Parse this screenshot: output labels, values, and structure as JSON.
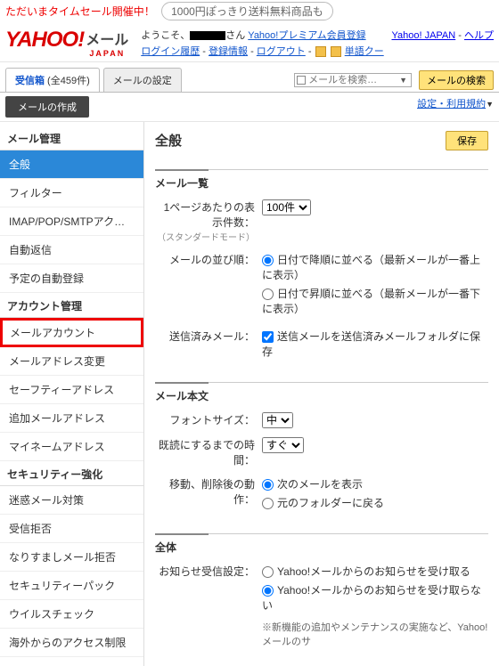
{
  "promo": {
    "sale": "ただいまタイムセール開催中！",
    "oval": "1000円ぽっきり送料無料商品も"
  },
  "header": {
    "yahoo": "YAHOO!",
    "japan": "JAPAN",
    "mail": "メール",
    "greeting_prefix": "ようこそ、",
    "greeting_suffix": "さん",
    "premium": "Yahoo!プレミアム会員登録",
    "login_history": "ログイン履歴",
    "reg_info": "登録情報",
    "logout": "ログアウト",
    "tango": "単語クー",
    "yj": "Yahoo! JAPAN",
    "help": "ヘルプ"
  },
  "tabs": {
    "inbox_label": "受信箱",
    "inbox_count": " (全459件)",
    "settings": "メールの設定"
  },
  "search": {
    "placeholder": "メールを検索…",
    "button": "メールの検索"
  },
  "subrow": {
    "compose": "メールの作成",
    "rules": "設定・利用規約"
  },
  "sidebar": {
    "h1": "メール管理",
    "g1": [
      "全般",
      "フィルター",
      "IMAP/POP/SMTPアク…",
      "自動返信",
      "予定の自動登録"
    ],
    "h2": "アカウント管理",
    "g2": [
      "メールアカウント",
      "メールアドレス変更",
      "セーフティーアドレス",
      "追加メールアドレス",
      "マイネームアドレス"
    ],
    "h3": "セキュリティー強化",
    "g3": [
      "迷惑メール対策",
      "受信拒否",
      "なりすましメール拒否",
      "セキュリティーパック",
      "ウイルスチェック",
      "海外からのアクセス制限"
    ]
  },
  "content": {
    "title": "全般",
    "save": "保存",
    "sec_list": "メール一覧",
    "per_page_label": "1ページあたりの表示件数：",
    "per_page_sub": "（スタンダードモード）",
    "per_page_value": "100件",
    "sort_label": "メールの並び順：",
    "sort_desc": "日付で降順に並べる（最新メールが一番上に表示）",
    "sort_asc": "日付で昇順に並べる（最新メールが一番下に表示）",
    "sent_label": "送信済みメール：",
    "sent_save": "送信メールを送信済みメールフォルダに保存",
    "sec_body": "メール本文",
    "font_label": "フォントサイズ：",
    "font_value": "中",
    "read_label": "既読にするまでの時間：",
    "read_value": "すぐ",
    "after_label": "移動、削除後の動作：",
    "after_next": "次のメールを表示",
    "after_back": "元のフォルダーに戻る",
    "sec_all": "全体",
    "notice_label": "お知らせ受信設定：",
    "notice_yes": "Yahoo!メールからのお知らせを受け取る",
    "notice_no": "Yahoo!メールからのお知らせを受け取らない",
    "notice_note": "※新機能の追加やメンテナンスの実施など、Yahoo!メールのサ"
  }
}
